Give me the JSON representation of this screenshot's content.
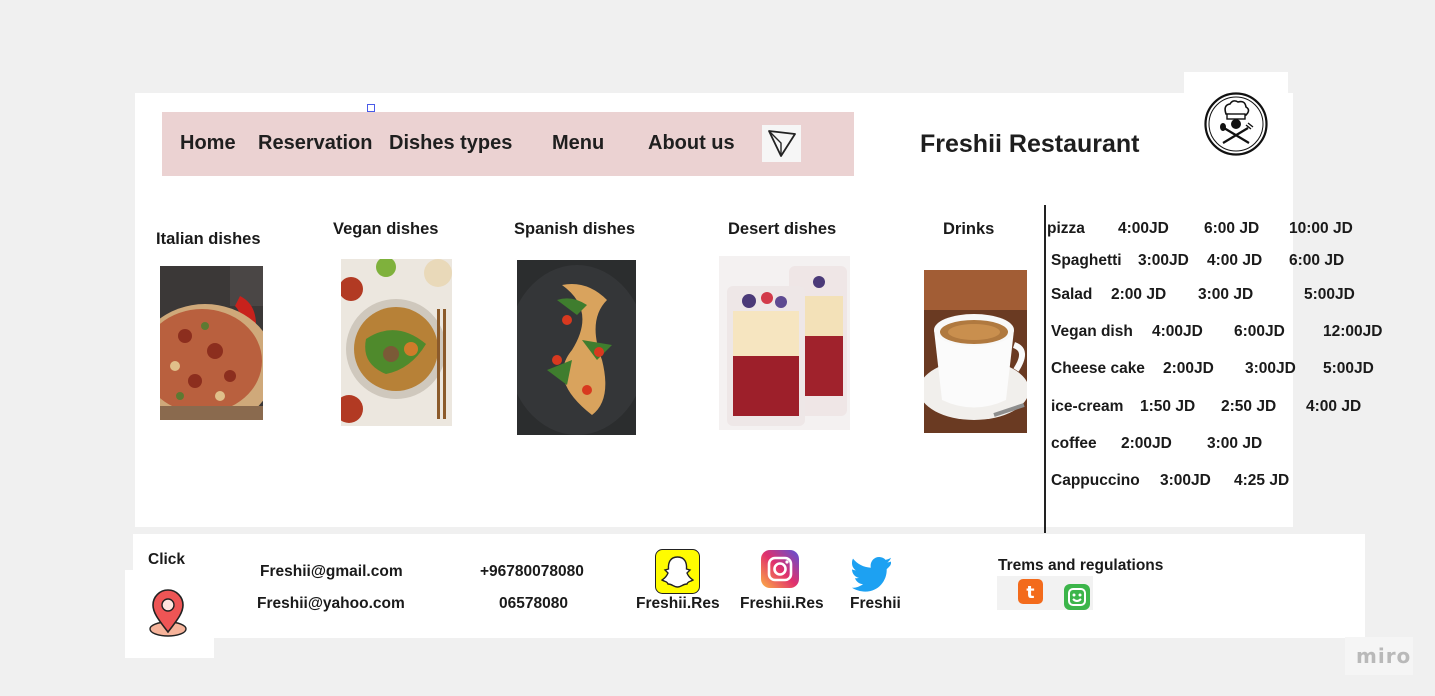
{
  "header": {
    "nav": [
      "Home",
      "Reservation",
      "Dishes types",
      "Menu",
      "About us"
    ],
    "title": "Freshii Restaurant",
    "logo_icon": "chef-hat-logo-icon",
    "dropdown_icon": "triangle-down-icon"
  },
  "categories": [
    "Italian dishes",
    "Vegan dishes",
    "Spanish dishes",
    "Desert dishes",
    "Drinks"
  ],
  "menu": [
    {
      "item": "pizza",
      "prices": [
        "4:00JD",
        "6:00 JD",
        "10:00 JD"
      ]
    },
    {
      "item": "Spaghetti",
      "prices": [
        "3:00JD",
        "4:00 JD",
        "6:00 JD"
      ]
    },
    {
      "item": "Salad",
      "prices": [
        "2:00 JD",
        "3:00 JD",
        "5:00JD"
      ]
    },
    {
      "item": "Vegan dish",
      "prices": [
        "4:00JD",
        "6:00JD",
        "12:00JD"
      ]
    },
    {
      "item": "Cheese cake",
      "prices": [
        "2:00JD",
        "3:00JD",
        "5:00JD"
      ]
    },
    {
      "item": "ice-cream",
      "prices": [
        "1:50 JD",
        "2:50 JD",
        "4:00 JD"
      ]
    },
    {
      "item": "coffee",
      "prices": [
        "2:00JD",
        "3:00 JD"
      ]
    },
    {
      "item": "Cappuccino",
      "prices": [
        "3:00JD",
        "4:25 JD"
      ]
    }
  ],
  "footer": {
    "click_label": "Click",
    "emails": [
      "Freshii@gmail.com",
      "Freshii@yahoo.com"
    ],
    "phones": [
      "+96780078080",
      "06578080"
    ],
    "socials": [
      {
        "name": "Freshii.Res",
        "icon": "snapchat-icon"
      },
      {
        "name": "Freshii.Res",
        "icon": "instagram-icon"
      },
      {
        "name": "Freshii",
        "icon": "twitter-icon"
      }
    ],
    "terms": "Trems and regulations",
    "location_icon": "map-pin-icon"
  },
  "watermark": "miro",
  "colors": {
    "nav_bg": "#ebd2d2",
    "canvas": "#f0f0f0",
    "panel": "#ffffff"
  }
}
